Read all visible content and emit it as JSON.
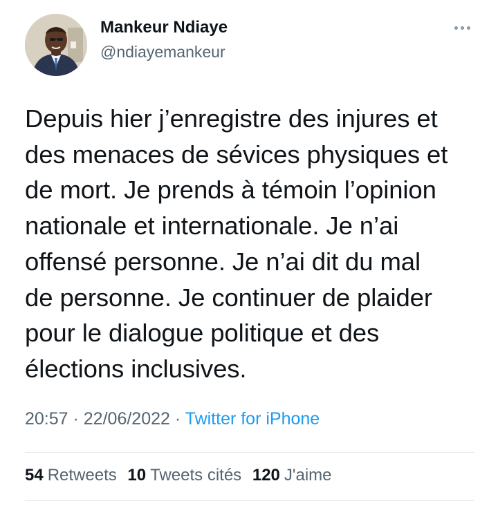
{
  "author": {
    "name": "Mankeur Ndiaye",
    "handle": "@ndiayemankeur"
  },
  "tweet": {
    "lines": [
      "Depuis hier j’enregistre des injures et",
      "des menaces de sévices physiques et",
      "de mort. Je prends à témoin l’opinion",
      "nationale et internationale. Je n’ai",
      "offensé personne. Je n’ai dit du mal",
      "de personne. Je continuer de plaider",
      "pour le dialogue politique et des",
      "élections inclusives."
    ]
  },
  "meta": {
    "time": "20:57",
    "separator": " · ",
    "date": "22/06/2022",
    "source": "Twitter for iPhone"
  },
  "stats": {
    "retweets_count": "54",
    "retweets_label": "Retweets",
    "quotes_count": "10",
    "quotes_label": "Tweets cités",
    "likes_count": "120",
    "likes_label": "J'aime"
  },
  "colors": {
    "text": "#0f1419",
    "secondary": "#536471",
    "link": "#1d9bf0"
  },
  "icons": {
    "more": "more-horizontal-icon",
    "avatar": "profile-photo"
  }
}
